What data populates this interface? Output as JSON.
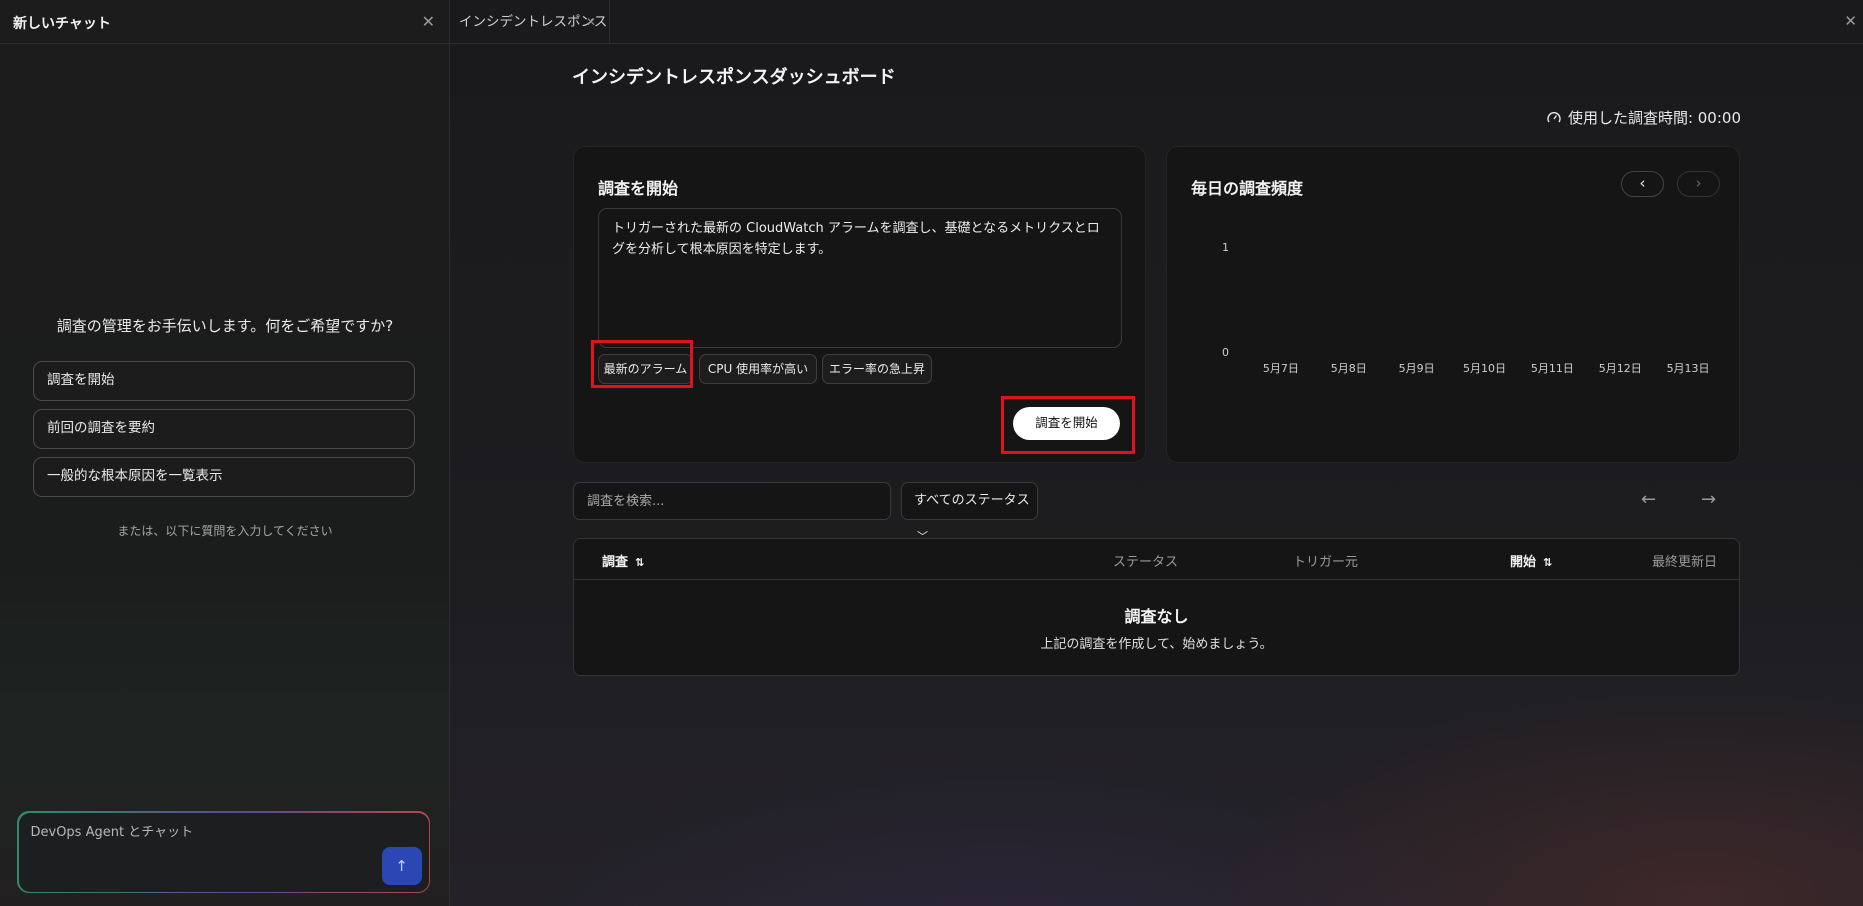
{
  "chat": {
    "title": "新しいチャット",
    "prompt": "調査の管理をお手伝いします。何をご希望ですか?",
    "suggestions": [
      "調査を開始",
      "前回の調査を要約",
      "一般的な根本原因を一覧表示"
    ],
    "or_text": "または、以下に質問を入力してください",
    "input_placeholder": "DevOps Agent とチャット"
  },
  "tabs": [
    {
      "label": "インシデントレスポンス"
    }
  ],
  "page": {
    "title": "インシデントレスポンスダッシュボード",
    "timer": "使用した調査時間: 00:00"
  },
  "start_card": {
    "title": "調査を開始",
    "prompt_text": "トリガーされた最新の CloudWatch アラームを調査し、基礎となるメトリクスとログを分析して根本原因を特定します。",
    "chips": [
      "最新のアラーム",
      "CPU 使用率が高い",
      "エラー率の急上昇"
    ],
    "start_button": "調査を開始"
  },
  "freq_card": {
    "title": "毎日の調査頻度"
  },
  "chart_data": {
    "type": "bar",
    "categories": [
      "5月7日",
      "5月8日",
      "5月9日",
      "5月10日",
      "5月11日",
      "5月12日",
      "5月13日"
    ],
    "values": [
      0,
      0,
      0,
      0,
      0,
      0,
      0
    ],
    "ylim": [
      0,
      1
    ],
    "yticks": [
      "1",
      "0"
    ],
    "grid": false
  },
  "search": {
    "placeholder": "調査を検索...",
    "status_filter": "すべてのステータス"
  },
  "table": {
    "columns": [
      "調査",
      "ステータス",
      "トリガー元",
      "開始",
      "最終更新日"
    ],
    "empty_title": "調査なし",
    "empty_desc": "上記の調査を作成して、始めましょう。"
  },
  "colors": {
    "highlight": "#e0121c",
    "send_button": "#2b47b3"
  }
}
